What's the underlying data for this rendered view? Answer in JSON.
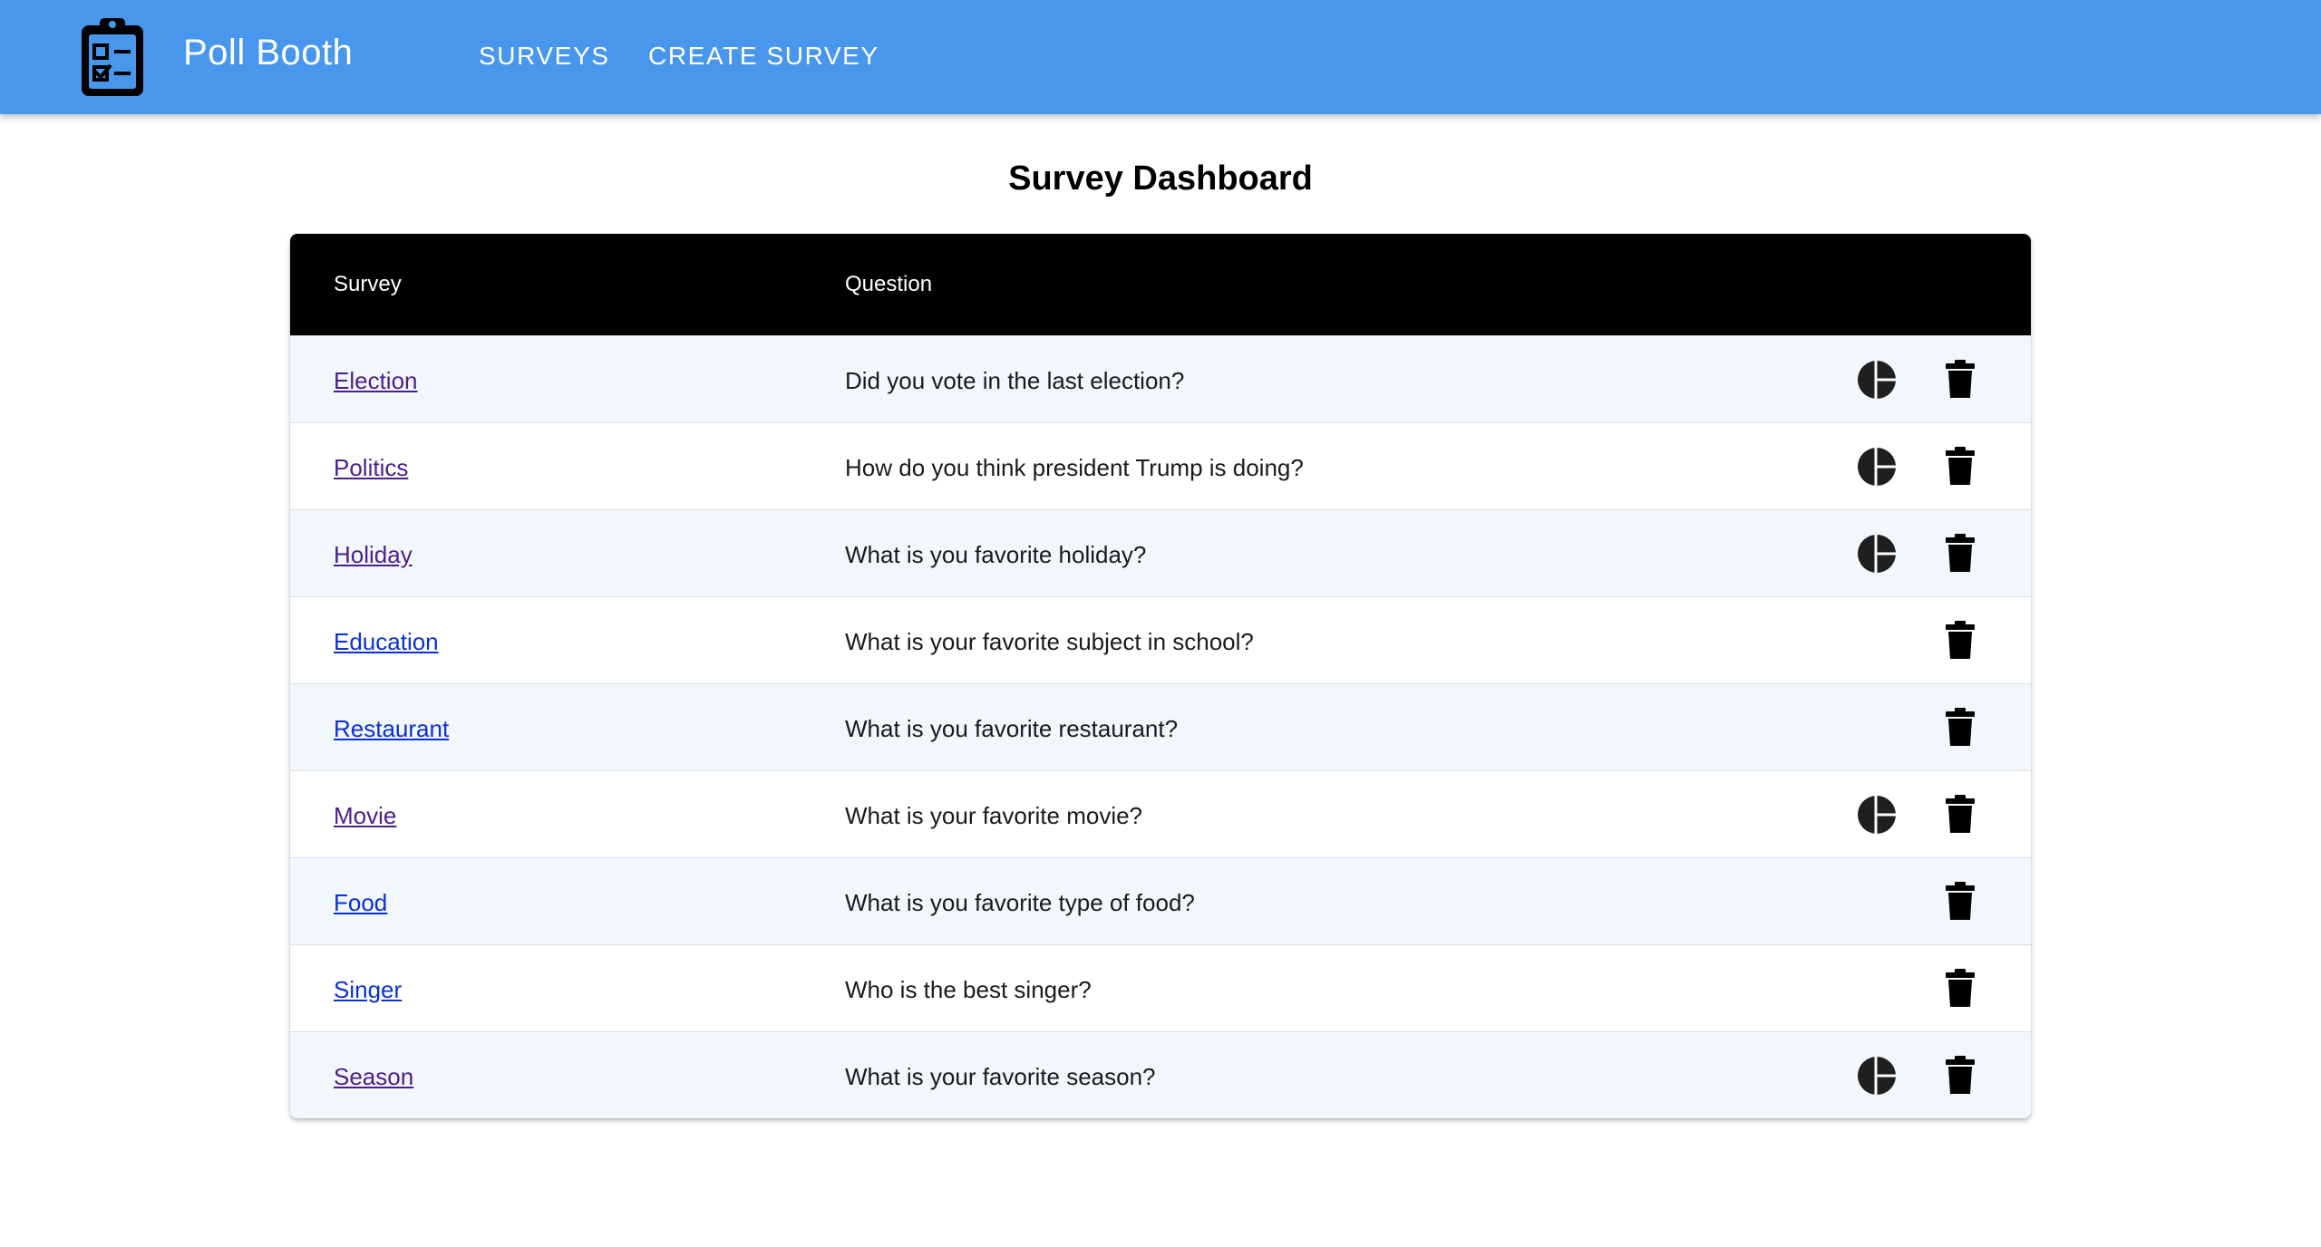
{
  "app": {
    "brand": "Poll Booth",
    "nav": [
      {
        "label": "SURVEYS"
      },
      {
        "label": "CREATE SURVEY"
      }
    ],
    "colors": {
      "appbar": "#4897ec",
      "link_visited": "#4b1f8a",
      "link_unvisited": "#0b2fd6"
    }
  },
  "page": {
    "title": "Survey Dashboard"
  },
  "table": {
    "headers": {
      "survey": "Survey",
      "question": "Question"
    },
    "rows": [
      {
        "survey": "Election",
        "question": "Did you vote in the last election?",
        "has_results": true,
        "visited": true
      },
      {
        "survey": "Politics",
        "question": "How do you think president Trump is doing?",
        "has_results": true,
        "visited": true
      },
      {
        "survey": "Holiday",
        "question": "What is you favorite holiday?",
        "has_results": true,
        "visited": true
      },
      {
        "survey": "Education",
        "question": "What is your favorite subject in school?",
        "has_results": false,
        "visited": false
      },
      {
        "survey": "Restaurant",
        "question": "What is you favorite restaurant?",
        "has_results": false,
        "visited": false
      },
      {
        "survey": "Movie",
        "question": "What is your favorite movie?",
        "has_results": true,
        "visited": true
      },
      {
        "survey": "Food",
        "question": "What is you favorite type of food?",
        "has_results": false,
        "visited": false
      },
      {
        "survey": "Singer",
        "question": "Who is the best singer?",
        "has_results": false,
        "visited": false
      },
      {
        "survey": "Season",
        "question": "What is your favorite season?",
        "has_results": true,
        "visited": true
      }
    ],
    "icons": {
      "results": "pie-chart-icon",
      "delete": "trash-icon",
      "logo": "clipboard-checklist-icon"
    }
  }
}
